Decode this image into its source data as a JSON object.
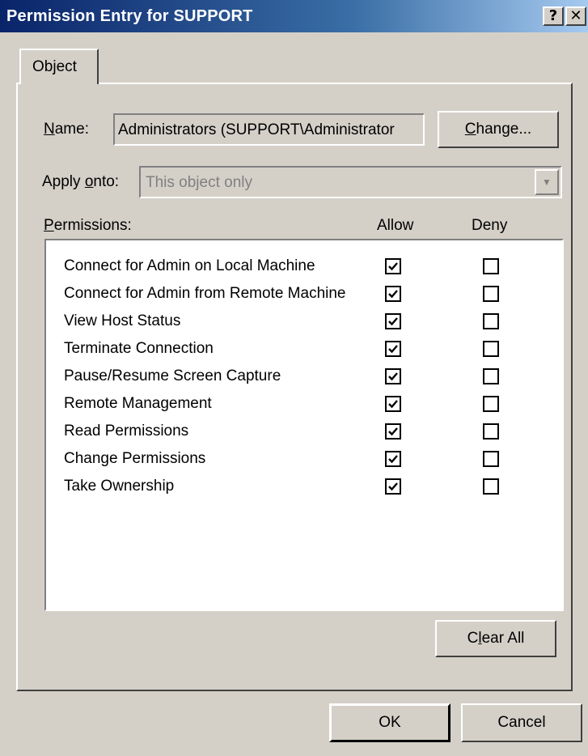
{
  "window": {
    "title": "Permission Entry for SUPPORT",
    "help_glyph": "?",
    "close_glyph": "✕"
  },
  "tabs": [
    {
      "label": "Object",
      "active": true
    }
  ],
  "name_row": {
    "label_underlined": "N",
    "label_rest": "ame:",
    "value": "Administrators (SUPPORT\\Administrator",
    "change_underlined": "C",
    "change_rest": "hange..."
  },
  "apply_row": {
    "label_pre": "Apply ",
    "label_underlined": "o",
    "label_post": "nto:",
    "value": "This object only",
    "disabled": true
  },
  "permissions": {
    "label_underlined": "P",
    "label_rest": "ermissions:",
    "allow_header": "Allow",
    "deny_header": "Deny",
    "rows": [
      {
        "name": "Connect for Admin on Local Machine",
        "allow": true,
        "deny": false
      },
      {
        "name": "Connect for Admin from Remote Machine",
        "allow": true,
        "deny": false
      },
      {
        "name": "View Host Status",
        "allow": true,
        "deny": false
      },
      {
        "name": "Terminate Connection",
        "allow": true,
        "deny": false
      },
      {
        "name": "Pause/Resume Screen Capture",
        "allow": true,
        "deny": false
      },
      {
        "name": "Remote Management",
        "allow": true,
        "deny": false
      },
      {
        "name": "Read Permissions",
        "allow": true,
        "deny": false
      },
      {
        "name": "Change Permissions",
        "allow": true,
        "deny": false
      },
      {
        "name": "Take Ownership",
        "allow": true,
        "deny": false
      }
    ]
  },
  "buttons": {
    "clear_pre": "C",
    "clear_underlined": "l",
    "clear_post": "ear All",
    "ok": "OK",
    "cancel": "Cancel"
  }
}
